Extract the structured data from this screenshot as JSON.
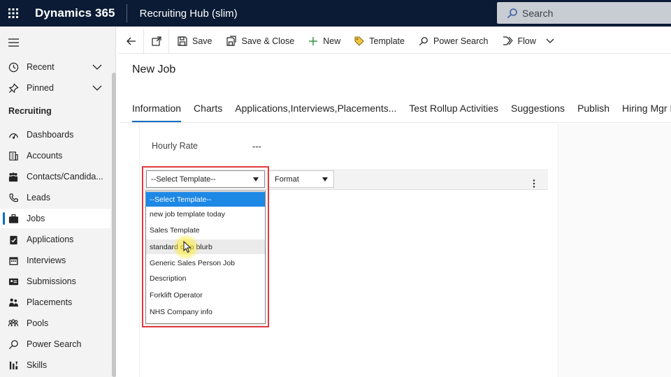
{
  "topbar": {
    "app_name": "Dynamics 365",
    "area_name": "Recruiting Hub (slim)",
    "search_placeholder": "Search"
  },
  "sidebar": {
    "recent_label": "Recent",
    "pinned_label": "Pinned",
    "section_label": "Recruiting",
    "items": [
      {
        "label": "Dashboards",
        "icon": "dashboard-icon"
      },
      {
        "label": "Accounts",
        "icon": "building-icon"
      },
      {
        "label": "Contacts/Candida...",
        "icon": "people-icon"
      },
      {
        "label": "Leads",
        "icon": "phone-icon"
      },
      {
        "label": "Jobs",
        "icon": "briefcase-icon"
      },
      {
        "label": "Applications",
        "icon": "clipboard-check-icon"
      },
      {
        "label": "Interviews",
        "icon": "calendar-icon"
      },
      {
        "label": "Submissions",
        "icon": "id-card-icon"
      },
      {
        "label": "Placements",
        "icon": "group-icon"
      },
      {
        "label": "Pools",
        "icon": "pool-people-icon"
      },
      {
        "label": "Power Search",
        "icon": "search-icon"
      },
      {
        "label": "Skills",
        "icon": "skills-icon"
      }
    ],
    "active_item": "Jobs"
  },
  "commandbar": {
    "save": "Save",
    "save_close": "Save & Close",
    "new": "New",
    "template": "Template",
    "power_search": "Power Search",
    "flow": "Flow"
  },
  "page": {
    "title": "New Job",
    "tabs": [
      "Information",
      "Charts",
      "Applications,Interviews,Placements...",
      "Test Rollup Activities",
      "Suggestions",
      "Publish",
      "Hiring Mgr Po"
    ],
    "active_tab": "Information"
  },
  "form": {
    "hourly_rate_label": "Hourly Rate",
    "hourly_rate_value": "---",
    "template_select_value": "--Select Template--",
    "format_select_value": "Format",
    "template_options": [
      "--Select Template--",
      "new job template today",
      "Sales Template",
      "standard co  p blurb",
      "Generic Sales Person Job",
      "Description",
      "Forklift Operator",
      "NHS Company info"
    ]
  },
  "colors": {
    "topbar_bg": "#0b1b35",
    "accent": "#0f6cbd",
    "selected_option": "#1e88e5",
    "highlight_frame": "#e0393e"
  }
}
